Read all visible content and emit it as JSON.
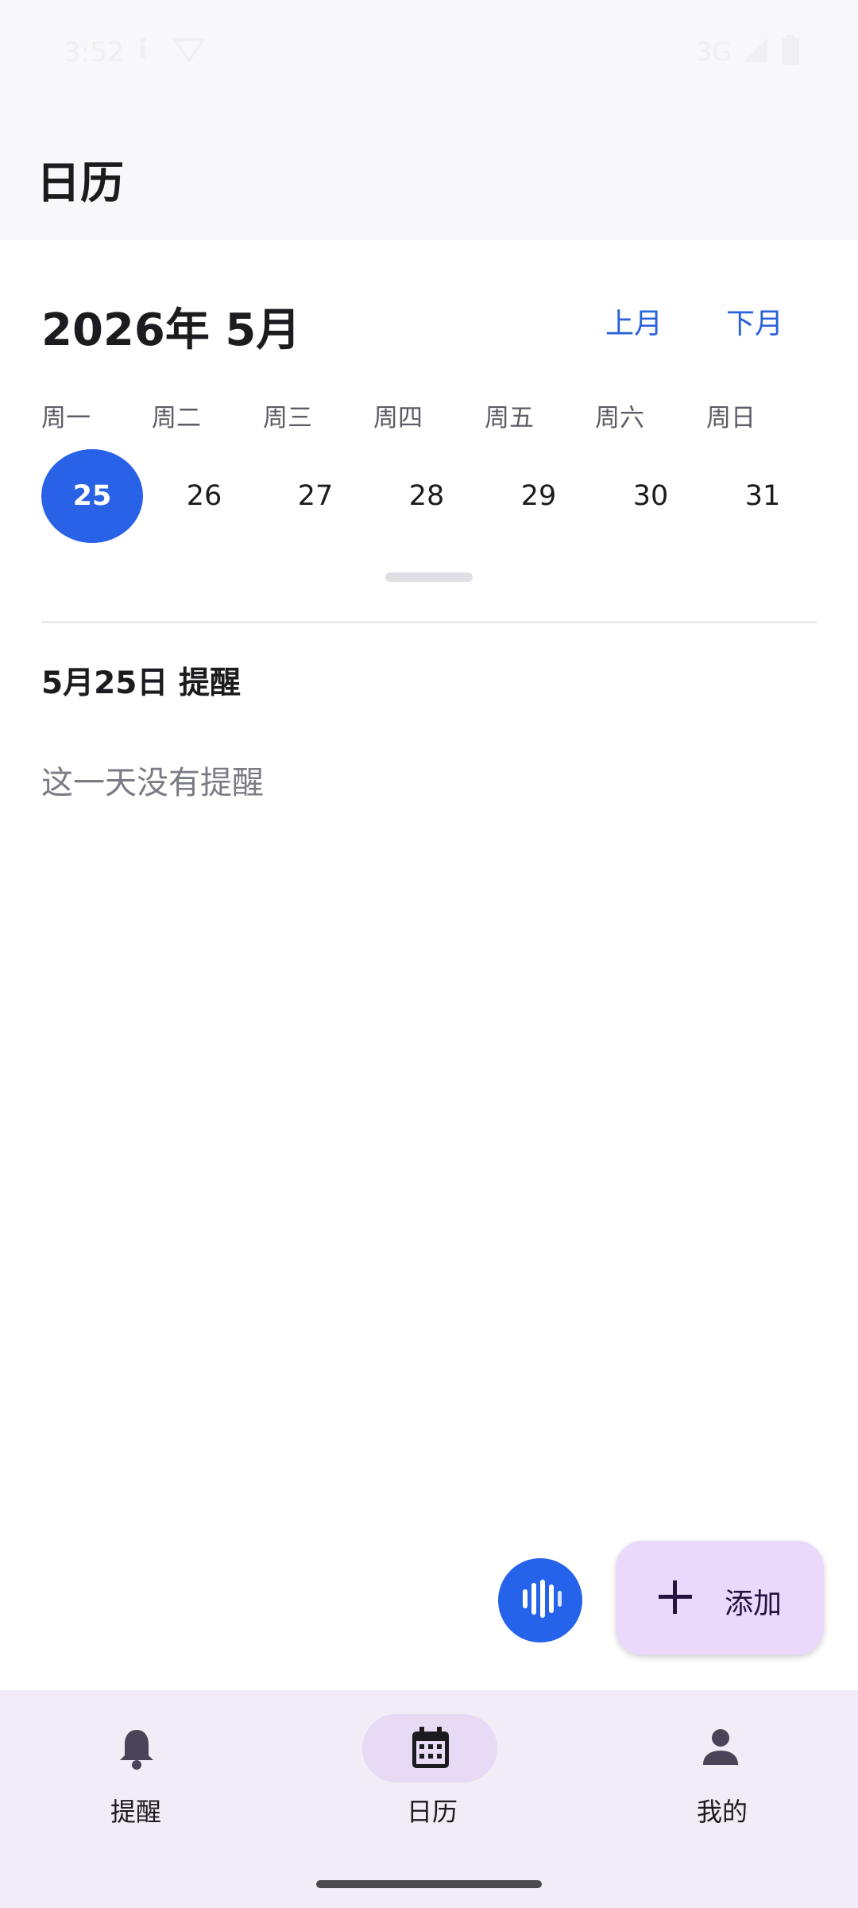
{
  "status_bar": {
    "time": "3:52",
    "network": "3G",
    "icons": [
      "accessibility-icon",
      "vpn-icon",
      "signal-icon",
      "battery-icon"
    ]
  },
  "app_bar": {
    "title": "日历"
  },
  "calendar": {
    "month_title": "2026年 5月",
    "prev_label": "上月",
    "next_label": "下月",
    "weekdays": [
      "周一",
      "周二",
      "周三",
      "周四",
      "周五",
      "周六",
      "周日"
    ],
    "dates": [
      "25",
      "26",
      "27",
      "28",
      "29",
      "30",
      "31"
    ],
    "selected_date": "25"
  },
  "reminders": {
    "section_title": "5月25日 提醒",
    "empty_text": "这一天没有提醒"
  },
  "fab": {
    "voice_icon": "voice-wave-icon",
    "add_label": "添加",
    "add_icon": "plus-icon"
  },
  "bottom_nav": {
    "items": [
      {
        "label": "提醒",
        "icon": "bell-icon",
        "active": false
      },
      {
        "label": "日历",
        "icon": "calendar-icon",
        "active": true
      },
      {
        "label": "我的",
        "icon": "person-icon",
        "active": false
      }
    ]
  },
  "colors": {
    "accent": "#2962e6",
    "link": "#2962d9",
    "fab_container": "#ead9fb",
    "nav_background": "#f1ecf5",
    "nav_active_pill": "#e6daf4"
  }
}
